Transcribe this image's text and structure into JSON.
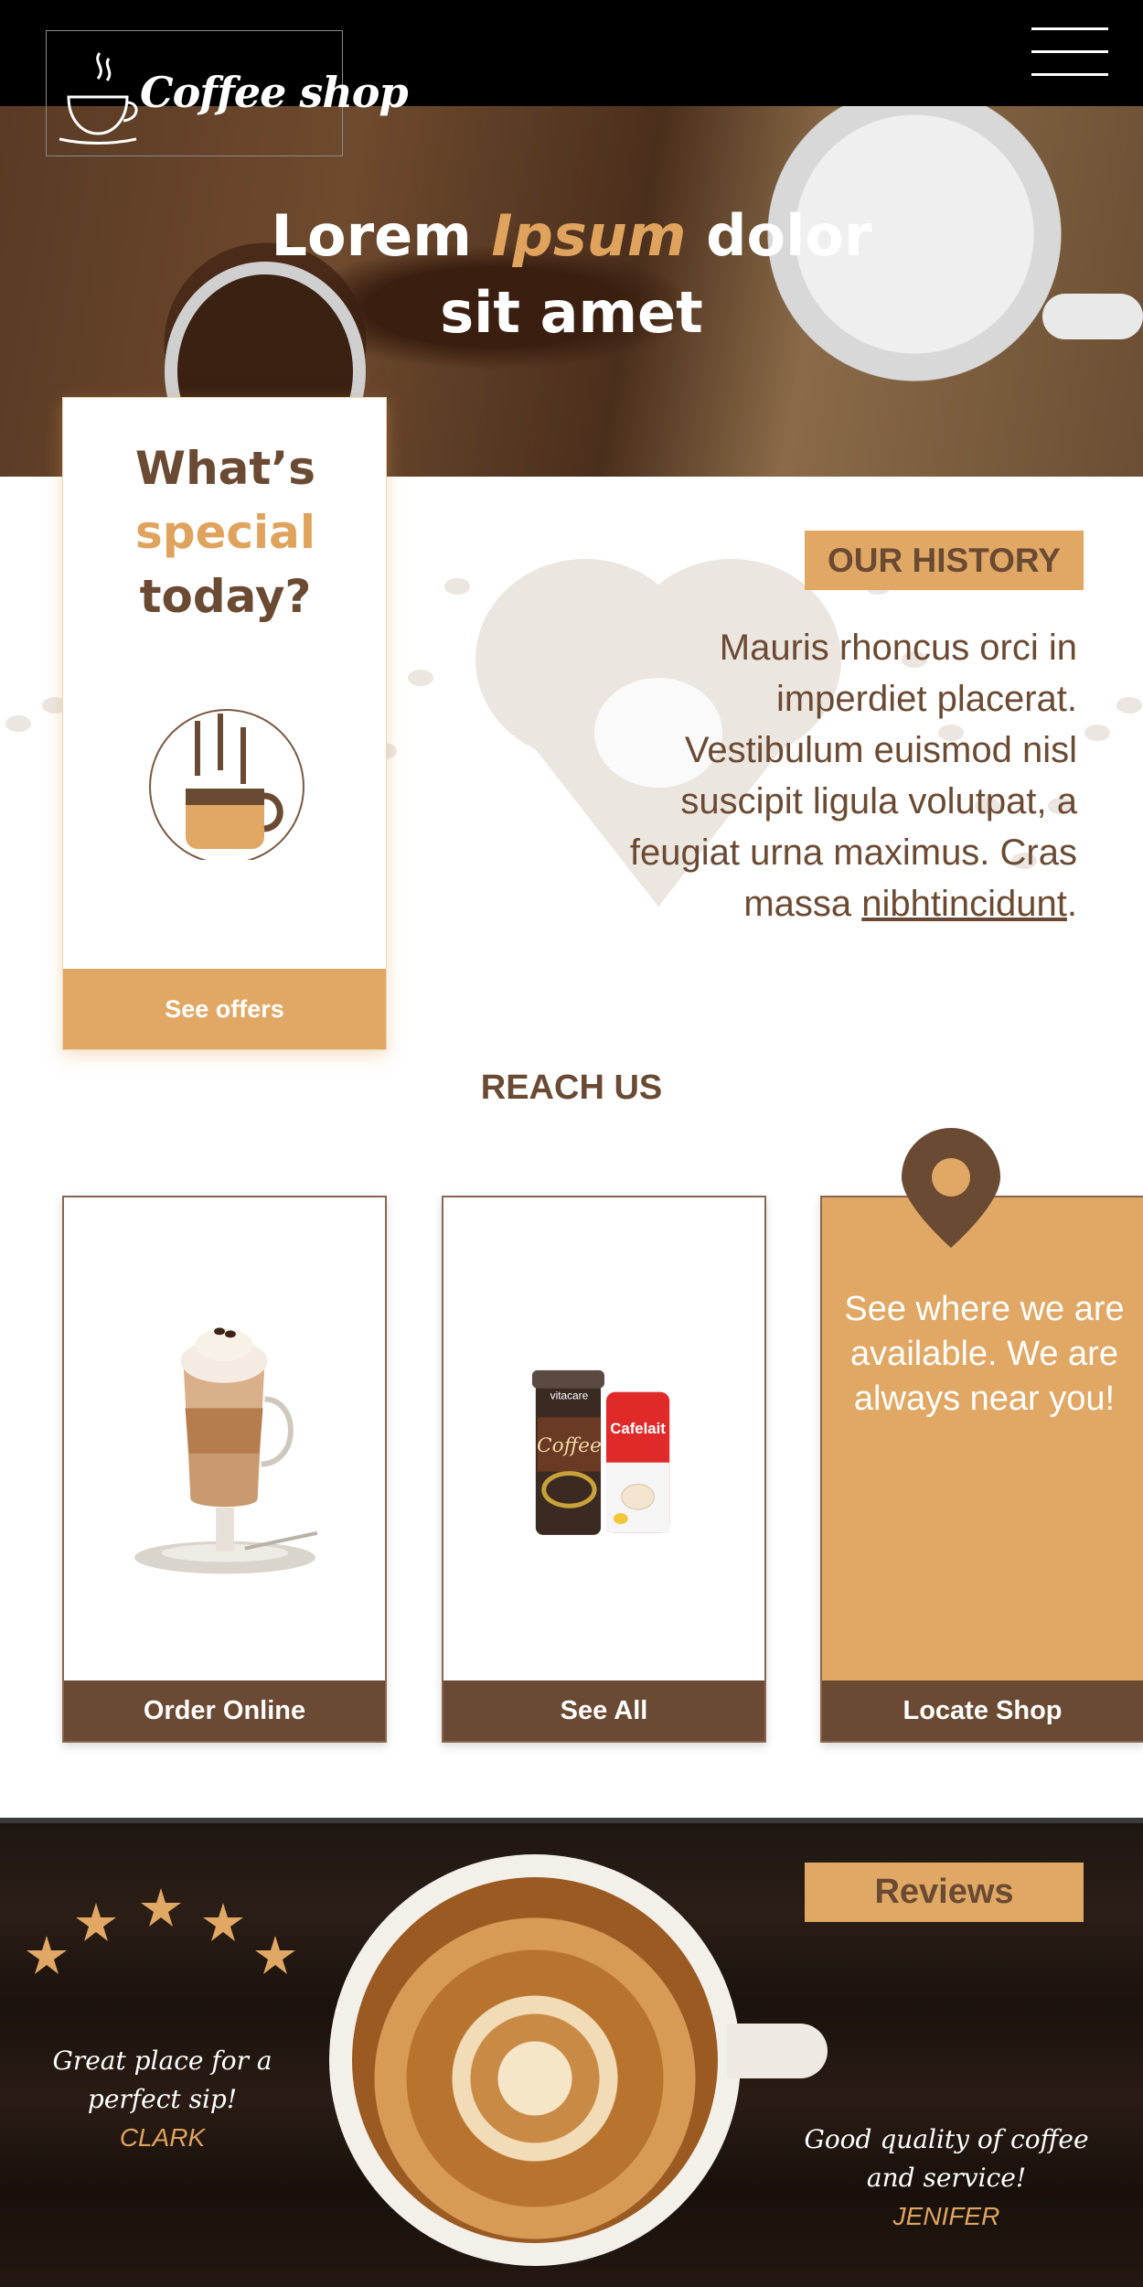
{
  "header": {
    "logo_text": "Coffee shop",
    "menu_icon": "hamburger-menu-icon"
  },
  "hero": {
    "title_part1": "Lorem ",
    "title_accent": "Ipsum",
    "title_part2": " dolor",
    "title_line2": "sit amet"
  },
  "special": {
    "line1": "What’s",
    "line2": "special",
    "line3": "today?",
    "icon": "steaming-cup-icon",
    "button_label": "See offers"
  },
  "history": {
    "tag": "OUR HISTORY",
    "text": "Mauris rhoncus orci in imperdiet placerat. Vestibulum euismod nisl suscipit ligula volutpat, a feugiat urna maximus. Cras massa ",
    "link_text": "nibhtincidunt",
    "text_end": "."
  },
  "reach": {
    "title": "REACH US",
    "cards": [
      {
        "button_label": "Order Online",
        "image": "latte-glass-image"
      },
      {
        "button_label": "See All",
        "image": "coffee-products-image"
      },
      {
        "button_label": "Locate Shop",
        "text": "See where we are available. We are always near you!",
        "icon": "location-pin-icon"
      }
    ],
    "product_labels": {
      "jar": "Coffee",
      "brand_top": "vitacare",
      "can": "Cafelait"
    }
  },
  "reviews": {
    "tag": "Reviews",
    "rating": 5,
    "items": [
      {
        "quote": "Great place for a perfect sip!",
        "name": "CLARK"
      },
      {
        "quote": "Good quality of coffee and service!",
        "name": "JENIFER"
      }
    ]
  },
  "colors": {
    "accent": "#e0a864",
    "brown": "#6b4a33",
    "header_bg": "#000000"
  }
}
